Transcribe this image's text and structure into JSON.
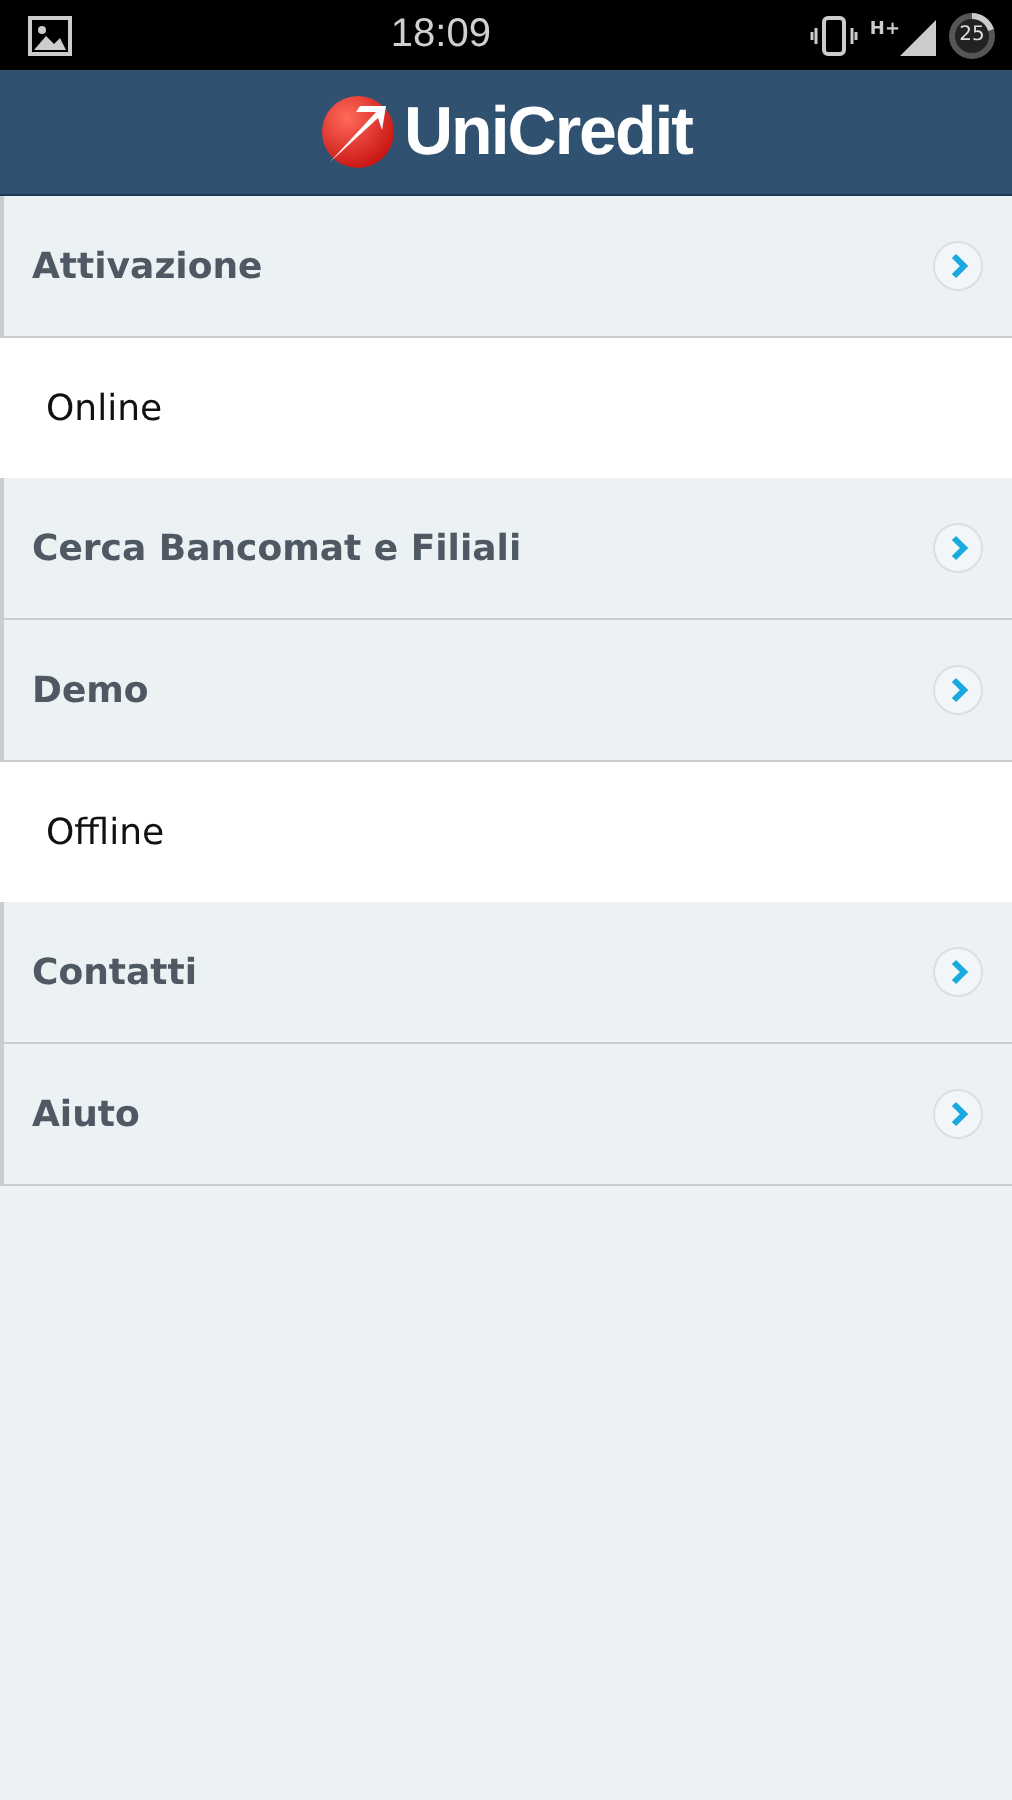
{
  "status_bar": {
    "time": "18:09",
    "network": "H+",
    "battery": "25"
  },
  "header": {
    "logo_text": "UniCredit"
  },
  "menu": [
    {
      "label": "Attivazione",
      "kind": "section"
    },
    {
      "label": "Online",
      "kind": "sub"
    },
    {
      "label": "Cerca Bancomat e Filiali",
      "kind": "section"
    },
    {
      "label": "Demo",
      "kind": "section"
    },
    {
      "label": "Offline",
      "kind": "sub"
    },
    {
      "label": "Contatti",
      "kind": "section"
    },
    {
      "label": "Aiuto",
      "kind": "section"
    }
  ]
}
